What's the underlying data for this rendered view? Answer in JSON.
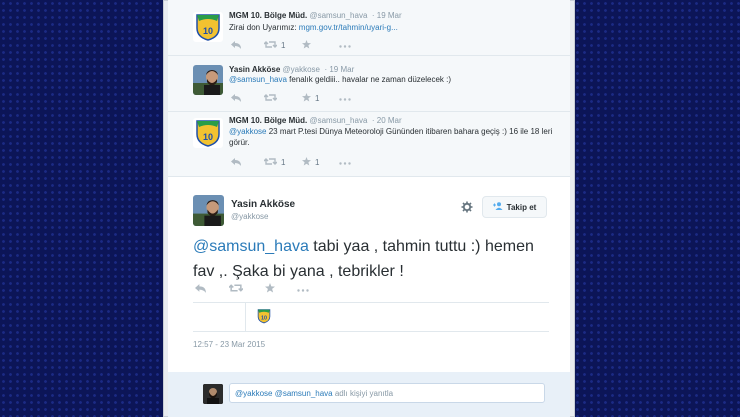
{
  "tweets": [
    {
      "name": "MGM 10. Bölge Müd.",
      "handle": "@samsun_hava",
      "date": "19 Mar",
      "text_prefix": "Zirai don Uyarımız: ",
      "text_link": "mgm.gov.tr/tahmin/uyari-g...",
      "retweets": "1",
      "favorites": ""
    },
    {
      "name": "Yasin Akköse",
      "handle": "@yakkose",
      "date": "19 Mar",
      "mention": "@samsun_hava",
      "text": " fenalık geldiii.. havalar ne zaman düzelecek :)",
      "retweets": "",
      "favorites": "1"
    },
    {
      "name": "MGM 10. Bölge Müd.",
      "handle": "@samsun_hava",
      "date": "20 Mar",
      "mention": "@yakkose",
      "text": " 23 mart P.tesi Dünya Meteoroloji Gününden itibaren bahara geçiş :) 16 ile 18 leri görür.",
      "retweets": "1",
      "favorites": "1"
    }
  ],
  "main_tweet": {
    "name": "Yasin Akköse",
    "handle": "@yakkose",
    "follow_label": "Takip et",
    "mention": "@samsun_hava",
    "text": " tabi yaa , tahmin tuttu :) hemen fav ,. Şaka bi yana , tebrikler !",
    "timestamp": "12:57 - 23 Mar 2015"
  },
  "reply": {
    "prefix": "@yakkose @samsun_hava",
    "placeholder": " adlı kişiyi yanıtla"
  },
  "colors": {
    "link": "#2b7bb9",
    "muted": "#8899a6",
    "text": "#292f33",
    "logo_yellow": "#f2c230",
    "logo_blue": "#1f4fa8"
  },
  "icons": [
    "reply-icon",
    "retweet-icon",
    "favorite-icon",
    "more-icon",
    "gear-icon",
    "follow-user-icon"
  ]
}
